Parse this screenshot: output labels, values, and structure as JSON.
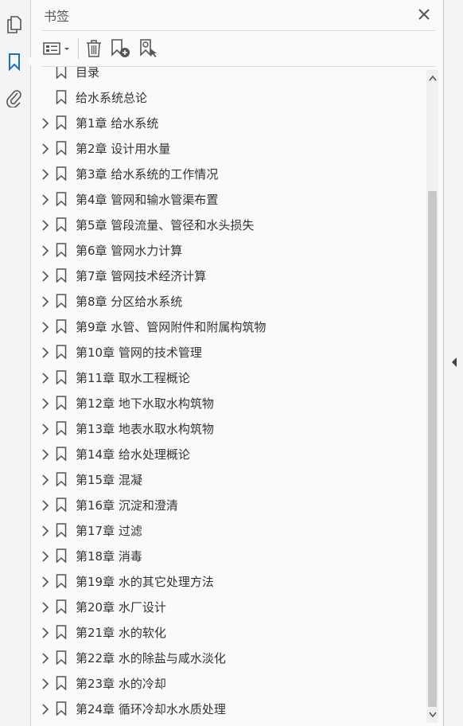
{
  "panel": {
    "title": "书签",
    "close_icon": "close-icon"
  },
  "rail": {
    "items": [
      {
        "name": "pages-icon",
        "active": false
      },
      {
        "name": "bookmark-icon",
        "active": true
      },
      {
        "name": "attachment-icon",
        "active": false
      }
    ]
  },
  "toolbar": {
    "buttons": [
      {
        "name": "options-menu-icon"
      },
      {
        "name": "delete-icon"
      },
      {
        "name": "new-bookmark-icon"
      },
      {
        "name": "bookmark-search-icon"
      }
    ]
  },
  "bookmarks": [
    {
      "label": "目录",
      "expandable": false
    },
    {
      "label": "给水系统总论",
      "expandable": false
    },
    {
      "label": "第1章  给水系统",
      "expandable": true
    },
    {
      "label": "第2章  设计用水量",
      "expandable": true
    },
    {
      "label": "第3章  给水系统的工作情况",
      "expandable": true
    },
    {
      "label": "第4章  管网和输水管渠布置",
      "expandable": true
    },
    {
      "label": "第5章  管段流量、管径和水头损失",
      "expandable": true
    },
    {
      "label": "第6章  管网水力计算",
      "expandable": true
    },
    {
      "label": "第7章  管网技术经济计算",
      "expandable": true
    },
    {
      "label": "第8章  分区给水系统",
      "expandable": true
    },
    {
      "label": "第9章  水管、管网附件和附属构筑物",
      "expandable": true
    },
    {
      "label": "第10章  管网的技术管理",
      "expandable": true
    },
    {
      "label": "第11章  取水工程概论",
      "expandable": true
    },
    {
      "label": "第12章  地下水取水构筑物",
      "expandable": true
    },
    {
      "label": "第13章  地表水取水构筑物",
      "expandable": true
    },
    {
      "label": "第14章  给水处理概论",
      "expandable": true
    },
    {
      "label": "第15章  混凝",
      "expandable": true
    },
    {
      "label": "第16章  沉淀和澄清",
      "expandable": true
    },
    {
      "label": "第17章  过滤",
      "expandable": true
    },
    {
      "label": "第18章  消毒",
      "expandable": true
    },
    {
      "label": "第19章  水的其它处理方法",
      "expandable": true
    },
    {
      "label": "第20章  水厂设计",
      "expandable": true
    },
    {
      "label": "第21章  水的软化",
      "expandable": true
    },
    {
      "label": "第22章  水的除盐与咸水淡化",
      "expandable": true
    },
    {
      "label": "第23章  水的冷却",
      "expandable": true
    },
    {
      "label": "第24章  循环冷却水水质处理",
      "expandable": true
    }
  ],
  "colors": {
    "accent": "#1a6fc4",
    "icon": "#555555",
    "scroll_thumb": "#c8c8c8"
  }
}
